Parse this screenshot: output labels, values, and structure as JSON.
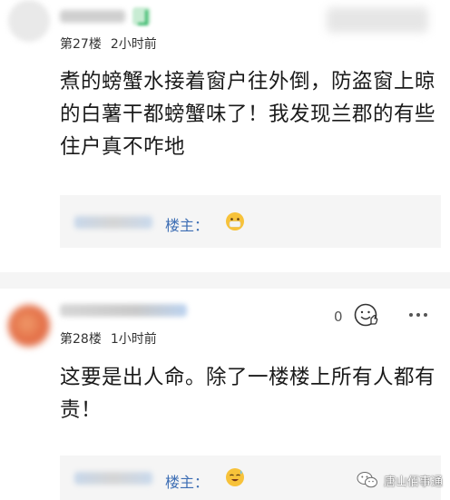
{
  "comments": [
    {
      "floor": "第27楼",
      "time": "2小时前",
      "text": "煮的螃蟹水接着窗户往外倒，防盗窗上晾的白薯干都螃蟹味了！我发现兰郡的有些住户真不咋地",
      "reply_label": "楼主："
    },
    {
      "floor": "第28楼",
      "time": "1小时前",
      "text": "这要是出人命。除了一楼楼上所有人都有责！",
      "like_count": "0",
      "reply_label": "楼主："
    }
  ],
  "watermark": {
    "text": "唐山佰事通",
    "icon": "wechat-icon"
  },
  "colors": {
    "reply_label": "#3d6eb4",
    "separator": "#f5f5f5",
    "reply_bg": "#f5f5f5"
  },
  "icons": {
    "like": "thumbs-up-face-icon",
    "more": "more-dots-icon",
    "reply_emoji_1": "mask-face-emoji-icon",
    "reply_emoji_2": "sweat-smile-emoji-icon"
  }
}
